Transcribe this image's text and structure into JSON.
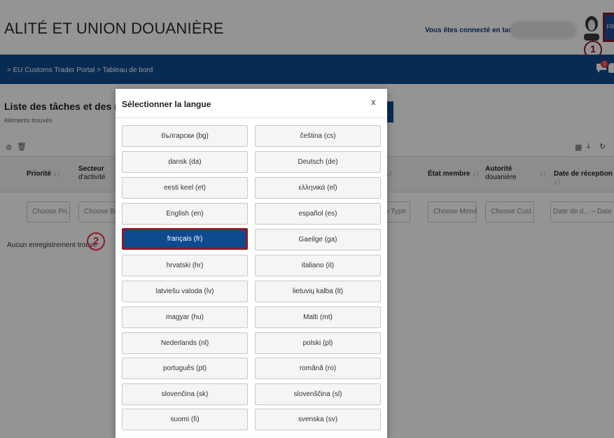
{
  "header": {
    "app_title": "ALITÉ ET UNION DOUANIÈRE",
    "logged_in_text": "Vous êtes connecté en tant q",
    "lang_button": "FR",
    "marker1": "1"
  },
  "nav": {
    "breadcrumb_sep1": ">",
    "breadcrumb_portal": "EU Customs Trader Portal",
    "breadcrumb_sep2": ">",
    "breadcrumb_dashboard": "Tableau de bord",
    "notification_count": "0"
  },
  "page": {
    "title": "Liste des tâches et des notification",
    "found_text": "éléments trouvés",
    "no_records": "Aucun enregistrement trouvé",
    "marker2": "2"
  },
  "table": {
    "headers": {
      "priority": "Priorité",
      "sector_line1": "Secteur",
      "sector_line2": "d'activité",
      "member_state": "État membre",
      "authority_line1": "Autorité",
      "authority_line2": "douanière",
      "reception_date": "Date de réception"
    },
    "filters": {
      "priority": "Choose Pri...",
      "business": "Choose Busi",
      "case_type": "se Type",
      "member": "Choose Memb...",
      "customs": "Choose Cust...",
      "date_from": "Date de d...",
      "date_sep": "–",
      "date_to": "Date de fin"
    }
  },
  "modal": {
    "title": "Sélectionner la langue",
    "close": "x",
    "languages": [
      "български (bg)",
      "čeština (cs)",
      "dansk (da)",
      "Deutsch (de)",
      "eesti keel (et)",
      "ελληνικά (el)",
      "English (en)",
      "español (es)",
      "français (fr)",
      "Gaeilge (ga)",
      "hrvatski (hr)",
      "italiano (it)",
      "latviešu valoda (lv)",
      "lietuvių kalba (lt)",
      "magyar (hu)",
      "Malti (mt)",
      "Nederlands (nl)",
      "polski (pl)",
      "português (pt)",
      "română (ro)",
      "slovenčina (sk)",
      "slovenščina (sl)",
      "suomi (fi)",
      "svenska (sv)"
    ],
    "selected_language": "français (fr)"
  },
  "colors": {
    "brand_blue": "#0e4a8f",
    "highlight_red": "#8b1b2a"
  }
}
